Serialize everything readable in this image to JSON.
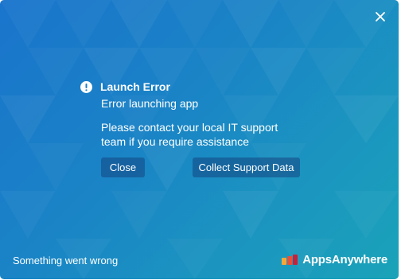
{
  "dialog": {
    "title": "Launch Error",
    "subtitle": "Error launching app",
    "message": "Please contact your local IT support team if you require assistance",
    "close_label": "Close",
    "collect_label": "Collect Support Data"
  },
  "footer": {
    "status": "Something went wrong",
    "brand": "AppsAnywhere"
  },
  "icons": {
    "close": "close-icon",
    "alert": "alert-icon",
    "brand_logo": "appsanywhere-logo-icon"
  },
  "colors": {
    "gradient_start": "#1a74cc",
    "gradient_end": "#1aa3b8",
    "text": "#ffffff"
  }
}
